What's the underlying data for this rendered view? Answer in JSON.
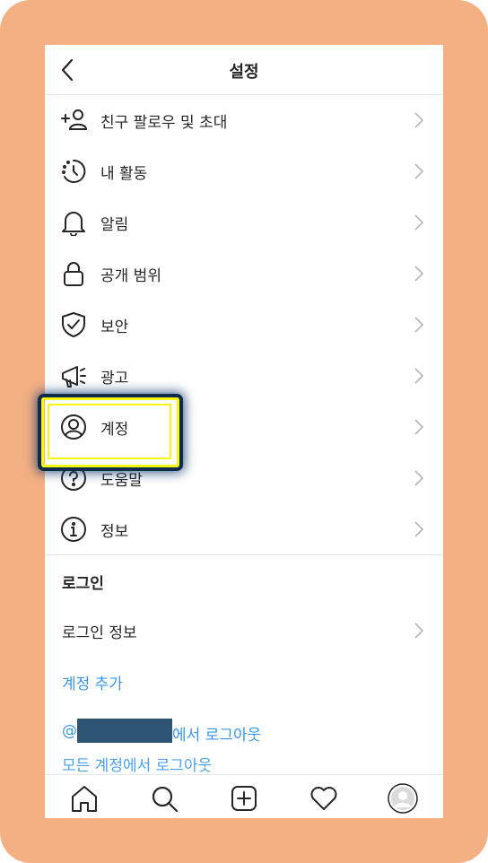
{
  "header": {
    "title": "설정"
  },
  "settings": [
    {
      "label": "친구 팔로우 및 초대",
      "icon": "add-person-icon"
    },
    {
      "label": "내 활동",
      "icon": "activity-clock-icon"
    },
    {
      "label": "알림",
      "icon": "bell-icon"
    },
    {
      "label": "공개 범위",
      "icon": "lock-icon"
    },
    {
      "label": "보안",
      "icon": "shield-check-icon"
    },
    {
      "label": "광고",
      "icon": "megaphone-icon"
    },
    {
      "label": "계정",
      "icon": "account-circle-icon"
    },
    {
      "label": "도움말",
      "icon": "help-circle-icon"
    },
    {
      "label": "정보",
      "icon": "info-circle-icon"
    }
  ],
  "login": {
    "section_title": "로그인",
    "login_info": "로그인 정보",
    "add_account": "계정 추가",
    "logout_prefix": "@",
    "logout_suffix": "에서 로그아웃",
    "logout_all_partial": "모든 계정에서 로그아웃"
  },
  "tabbar": [
    "home-icon",
    "search-icon",
    "add-post-icon",
    "heart-icon",
    "profile-avatar-icon"
  ],
  "colors": {
    "frame": "#f3b083",
    "link": "#3897f0",
    "highlight": "#f6f60f",
    "redaction": "#2f5574"
  }
}
